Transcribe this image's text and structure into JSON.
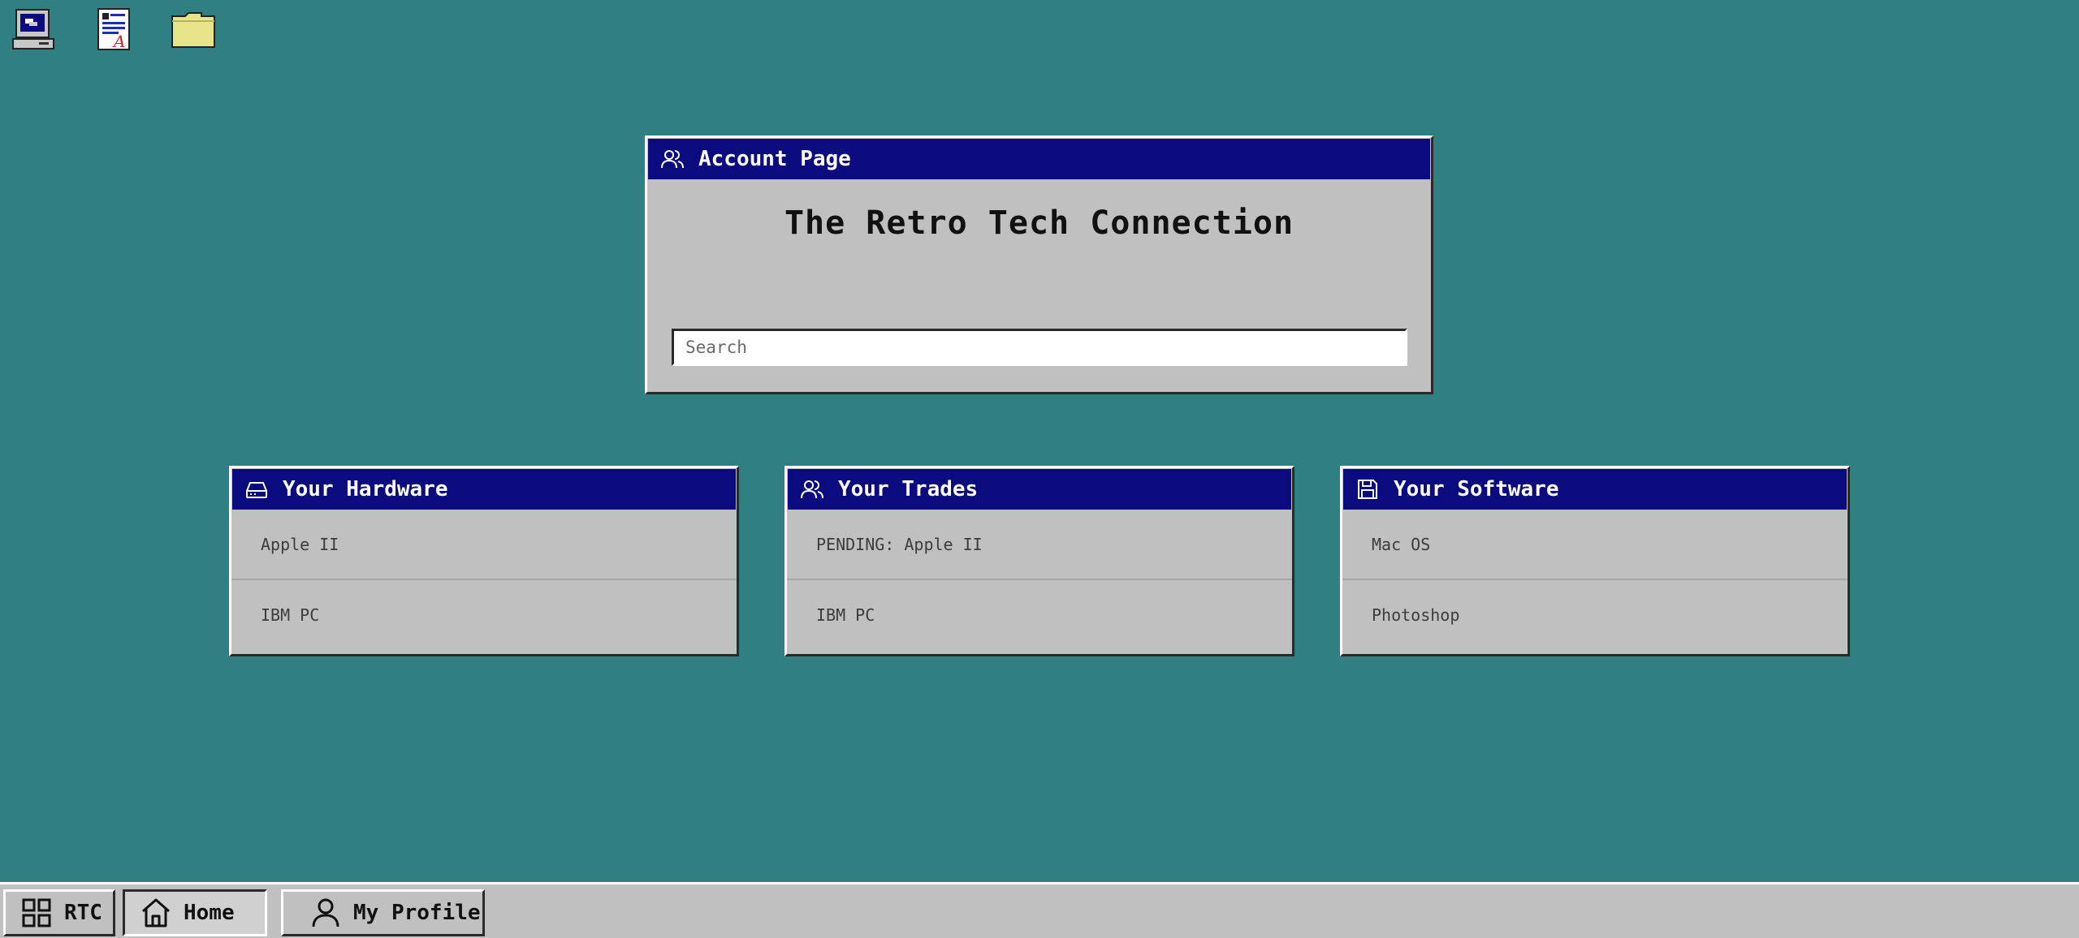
{
  "account_window": {
    "title": "Account Page",
    "headline": "The Retro Tech Connection",
    "search_placeholder": "Search"
  },
  "panels": {
    "hardware": {
      "title": "Your Hardware",
      "items": [
        "Apple II",
        "IBM PC"
      ]
    },
    "trades": {
      "title": "Your Trades",
      "items": [
        "PENDING: Apple II",
        "IBM PC"
      ]
    },
    "software": {
      "title": "Your Software",
      "items": [
        "Mac OS",
        "Photoshop"
      ]
    }
  },
  "taskbar": {
    "start_label": "RTC",
    "home_label": "Home",
    "profile_label": "My Profile"
  },
  "desktop_icons": [
    "my-computer-icon",
    "document-icon",
    "folder-icon"
  ],
  "colors": {
    "desktop": "#307f83",
    "titlebar": "#0b0a7e",
    "window": "#c0c0c0"
  }
}
